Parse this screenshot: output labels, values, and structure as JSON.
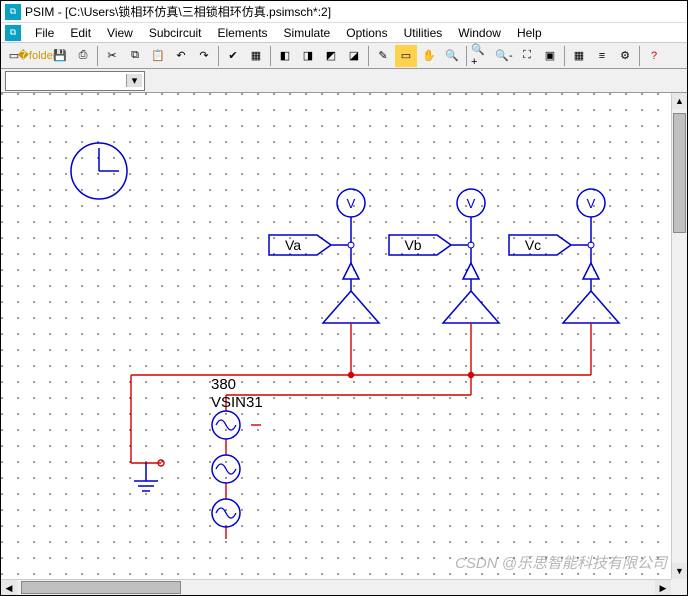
{
  "window": {
    "app": "PSIM",
    "path": "[C:\\Users\\锁相环仿真\\三相锁相环仿真.psimsch*:2]"
  },
  "menu": {
    "file": "File",
    "edit": "Edit",
    "view": "View",
    "subcircuit": "Subcircuit",
    "elements": "Elements",
    "simulate": "Simulate",
    "options": "Options",
    "utilities": "Utilities",
    "window": "Window",
    "help": "Help"
  },
  "labels": {
    "va": "Va",
    "vb": "Vb",
    "vc": "Vc",
    "v": "V",
    "amp": "380",
    "src": "VSIN31"
  },
  "combo": {
    "value": ""
  },
  "watermark": "CSDN @乐思智能科技有限公司"
}
